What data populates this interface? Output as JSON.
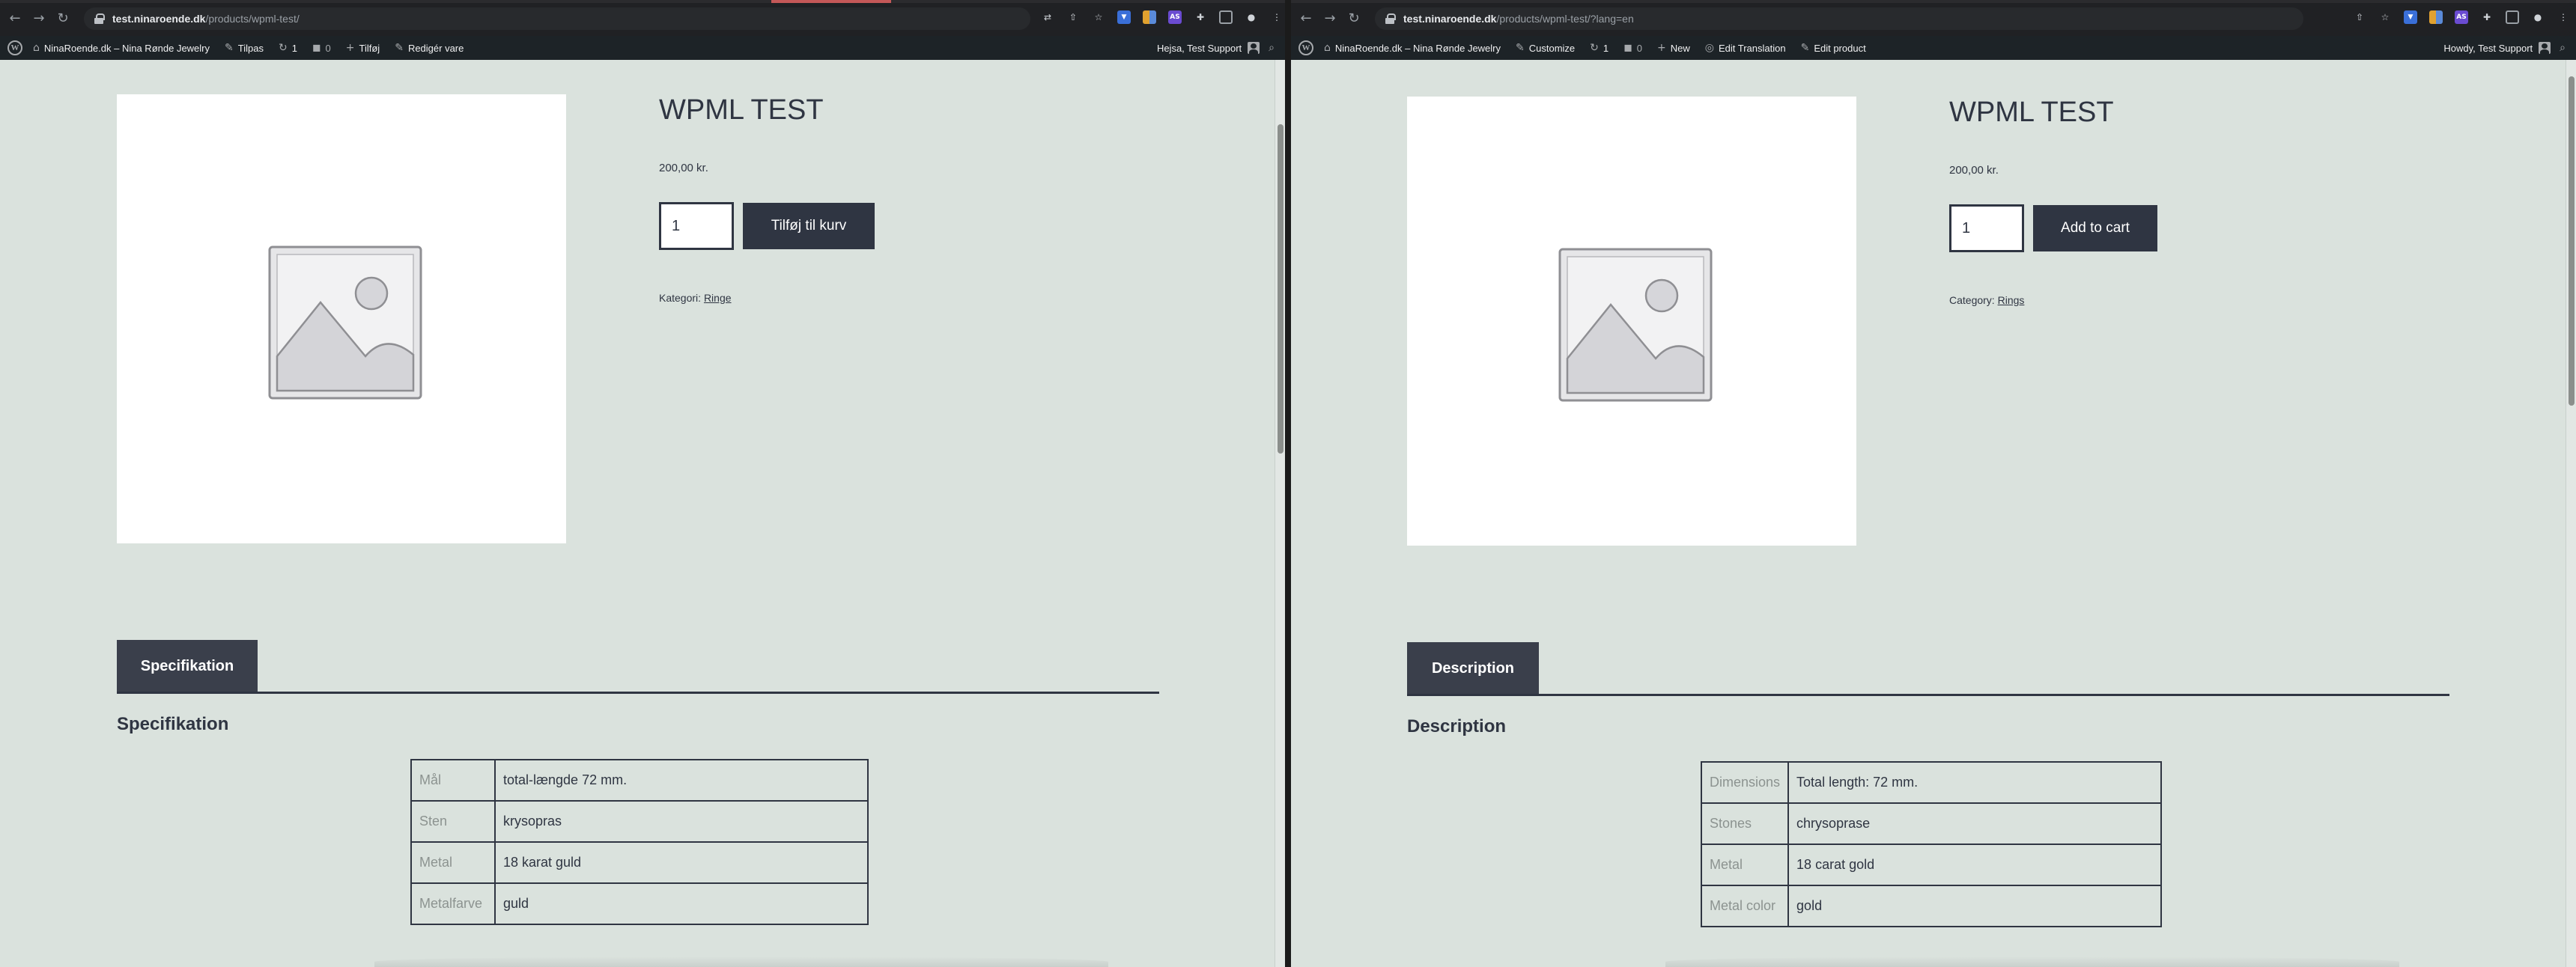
{
  "left": {
    "browser": {
      "url_host": "test.ninaroende.dk",
      "url_path": "/products/wpml-test/"
    },
    "adminbar": {
      "site_name": "NinaRoende.dk – Nina Rønde Jewelry",
      "customize": "Tilpas",
      "updates_count": "1",
      "comments_count": "0",
      "new": "Tilføj",
      "edit": "Redigér vare",
      "greeting": "Hejsa, Test Support"
    },
    "product": {
      "title": "WPML TEST",
      "price": "200,00 kr.",
      "qty": "1",
      "add_to_cart": "Tilføj til kurv",
      "category_label": "Kategori:",
      "category_link": "Ringe"
    },
    "tab": {
      "label": "Specifikation",
      "heading": "Specifikation"
    },
    "spec": [
      {
        "key": "Mål",
        "value": "total-længde 72 mm."
      },
      {
        "key": "Sten",
        "value": "krysopras"
      },
      {
        "key": "Metal",
        "value": "18 karat guld"
      },
      {
        "key": "Metalfarve",
        "value": "guld"
      }
    ]
  },
  "right": {
    "browser": {
      "url_host": "test.ninaroende.dk",
      "url_path": "/products/wpml-test/?lang=en"
    },
    "adminbar": {
      "site_name": "NinaRoende.dk – Nina Rønde Jewelry",
      "customize": "Customize",
      "updates_count": "1",
      "comments_count": "0",
      "new": "New",
      "edit_translation": "Edit Translation",
      "edit": "Edit product",
      "greeting": "Howdy, Test Support"
    },
    "product": {
      "title": "WPML TEST",
      "price": "200,00 kr.",
      "qty": "1",
      "add_to_cart": "Add to cart",
      "category_label": "Category:",
      "category_link": "Rings"
    },
    "tab": {
      "label": "Description",
      "heading": "Description"
    },
    "spec": [
      {
        "key": "Dimensions",
        "value": "Total length: 72 mm."
      },
      {
        "key": "Stones",
        "value": "chrysoprase"
      },
      {
        "key": "Metal",
        "value": "18 carat gold"
      },
      {
        "key": "Metal color",
        "value": "gold"
      }
    ]
  },
  "icons": {
    "back": "arrow-left-icon",
    "forward": "arrow-right-icon",
    "reload": "reload-icon",
    "lock": "lock-icon",
    "wordpress": "wordpress-logo-icon",
    "updates": "refresh-icon",
    "comments": "comment-bubble-icon",
    "plus": "plus-icon",
    "pencil": "pencil-icon",
    "search": "search-icon",
    "placeholder": "image-placeholder-icon"
  }
}
